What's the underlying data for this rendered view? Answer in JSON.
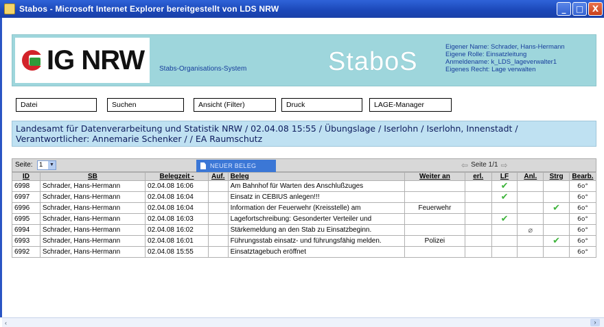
{
  "window": {
    "title": "Stabos - Microsoft Internet Explorer bereitgestellt von LDS NRW",
    "minimize": "_",
    "maximize": "□",
    "close": "X"
  },
  "header": {
    "logo_text": "IG NRW",
    "system_name": "Stabs-Organisations-System",
    "brand": "StaboS",
    "user_info": [
      "Eigener Name: Schrader, Hans-Hermann",
      "Eigene Rolle: Einsatzleitung",
      "Anmeldename: k_LDS_lageverwalter1",
      "Eigenes Recht: Lage verwalten"
    ],
    "header_bg": "#9ed6dc"
  },
  "menu": {
    "datei": "Datei",
    "suchen": "Suchen",
    "ansicht": "Ansicht (Filter)",
    "druck": "Druck",
    "lage_manager": "LAGE-Manager"
  },
  "context": {
    "line1": "Landesamt für Datenverarbeitung und Statistik NRW / 02.04.08 15:55 / Übungslage / Iserlohn / Iserlohn, Innenstadt /",
    "line2": "Verantwortlicher: Annemarie Schenker / / EA Raumschutz"
  },
  "table_toolbar": {
    "seite_label": "Seite:",
    "seite_value": "1",
    "new_button": "NEUER BELEG",
    "pager": "Seite 1/1"
  },
  "columns": {
    "id": "ID",
    "sb": "SB",
    "belegzeit": "Belegzeit -",
    "auf": "Auf.",
    "beleg": "Beleg",
    "weiter_an": "Weiter an",
    "erl": "erl.",
    "lf": "LF",
    "anl": "Anl.",
    "strg": "Strg",
    "bearb": "Bearb."
  },
  "rows": [
    {
      "id": "6998",
      "sb": "Schrader, Hans-Hermann",
      "zeit": "02.04.08 16:06",
      "auf": "",
      "beleg": "Am Bahnhof für Warten des Anschlußzuges",
      "weiter": "",
      "erl": "",
      "lf": "✔",
      "anl": "",
      "strg": "",
      "bearb": "6o°"
    },
    {
      "id": "6997",
      "sb": "Schrader, Hans-Hermann",
      "zeit": "02.04.08 16:04",
      "auf": "",
      "beleg": "Einsatz in CEBIUS anlegen!!!",
      "weiter": "",
      "erl": "",
      "lf": "✔",
      "anl": "",
      "strg": "",
      "bearb": "6o°"
    },
    {
      "id": "6996",
      "sb": "Schrader, Hans-Hermann",
      "zeit": "02.04.08 16:04",
      "auf": "",
      "beleg": "Information der Feuerwehr (Kreisstelle) am",
      "weiter": "Feuerwehr",
      "erl": "",
      "lf": "",
      "anl": "",
      "strg": "✔",
      "bearb": "6o°"
    },
    {
      "id": "6995",
      "sb": "Schrader, Hans-Hermann",
      "zeit": "02.04.08 16:03",
      "auf": "",
      "beleg": "Lagefortschreibung: Gesonderter Verteiler und",
      "weiter": "",
      "erl": "",
      "lf": "✔",
      "anl": "",
      "strg": "",
      "bearb": "6o°"
    },
    {
      "id": "6994",
      "sb": "Schrader, Hans-Hermann",
      "zeit": "02.04.08 16:02",
      "auf": "",
      "beleg": "Stärkemeldung an den Stab zu Einsatzbeginn.",
      "weiter": "",
      "erl": "",
      "lf": "",
      "anl": "⌀",
      "strg": "",
      "bearb": "6o°"
    },
    {
      "id": "6993",
      "sb": "Schrader, Hans-Hermann",
      "zeit": "02.04.08 16:01",
      "auf": "",
      "beleg": "Führungsstab einsatz- und führungsfähig melden.",
      "weiter": "Polizei",
      "erl": "",
      "lf": "",
      "anl": "",
      "strg": "✔",
      "bearb": "6o°"
    },
    {
      "id": "6992",
      "sb": "Schrader, Hans-Hermann",
      "zeit": "02.04.08 15:55",
      "auf": "",
      "beleg": "Einsatztagebuch eröffnet",
      "weiter": "",
      "erl": "",
      "lf": "",
      "anl": "",
      "strg": "",
      "bearb": "6o°"
    }
  ]
}
